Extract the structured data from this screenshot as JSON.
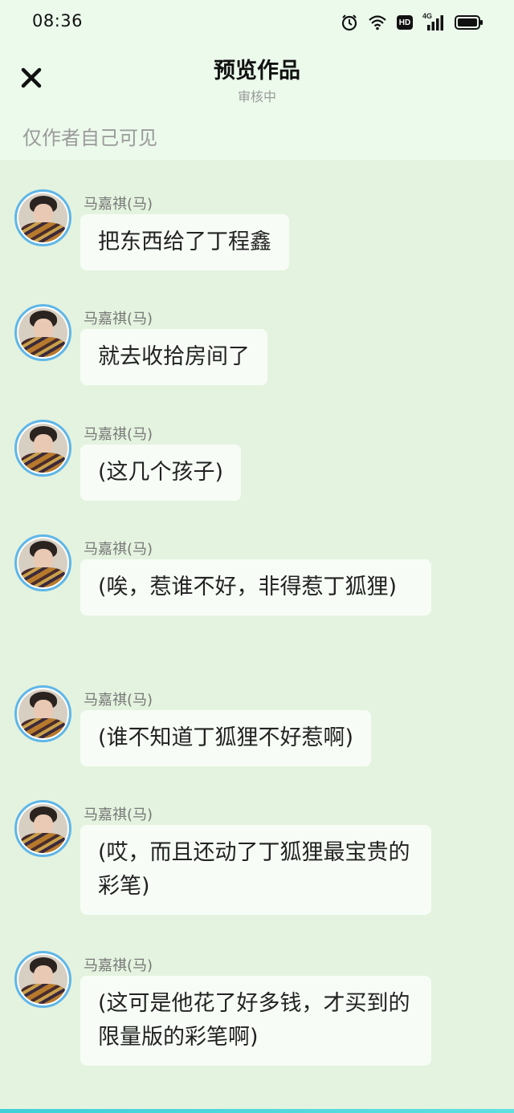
{
  "status_bar": {
    "time": "08:36",
    "icons": [
      "alarm-icon",
      "wifi-icon",
      "hd-icon",
      "signal-4g-icon",
      "battery-icon"
    ],
    "hd_label": "HD",
    "network_label": "4G"
  },
  "nav": {
    "close_icon": "close-icon",
    "title": "预览作品",
    "subtitle": "审核中"
  },
  "visibility_note": "仅作者自己可见",
  "messages": [
    {
      "sender": "马嘉祺(马)",
      "text": "把东西给了丁程鑫"
    },
    {
      "sender": "马嘉祺(马)",
      "text": "就去收拾房间了"
    },
    {
      "sender": "马嘉祺(马)",
      "text": "(这几个孩子)"
    },
    {
      "sender": "马嘉祺(马)",
      "text": "(唉，惹谁不好，非得惹丁狐狸)"
    },
    {
      "sender": "马嘉祺(马)",
      "text": "(谁不知道丁狐狸不好惹啊)"
    },
    {
      "sender": "马嘉祺(马)",
      "text": "(哎，而且还动了丁狐狸最宝贵的彩笔)"
    },
    {
      "sender": "马嘉祺(马)",
      "text": "(这可是他花了好多钱，才买到的限量版的彩笔啊)"
    }
  ],
  "colors": {
    "chat_background": "#e4f3df",
    "header_background": "#ecfaec",
    "bubble_background": "#f7fdf6",
    "avatar_border": "#5fb6e8"
  }
}
